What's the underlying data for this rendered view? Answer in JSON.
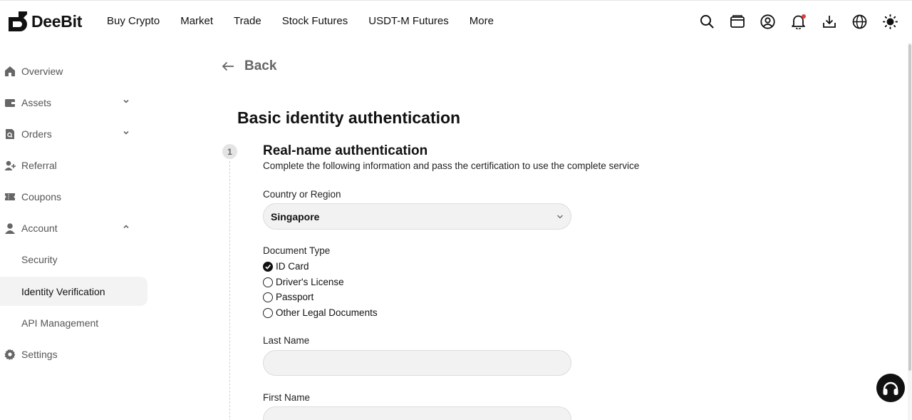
{
  "brand": {
    "name": "DeeBit"
  },
  "nav": {
    "items": [
      "Buy Crypto",
      "Market",
      "Trade",
      "Stock Futures",
      "USDT-M Futures",
      "More"
    ]
  },
  "header_icons": [
    "search-icon",
    "wallet-icon",
    "account-icon",
    "bell-icon",
    "download-icon",
    "globe-icon",
    "theme-sun-icon"
  ],
  "sidebar": {
    "items": [
      {
        "label": "Overview",
        "icon": "home-icon"
      },
      {
        "label": "Assets",
        "icon": "wallet-icon",
        "expand": "down"
      },
      {
        "label": "Orders",
        "icon": "orders-icon",
        "expand": "down"
      },
      {
        "label": "Referral",
        "icon": "referral-icon"
      },
      {
        "label": "Coupons",
        "icon": "coupon-icon"
      },
      {
        "label": "Account",
        "icon": "user-icon",
        "expand": "up"
      }
    ],
    "account_sub": [
      "Security",
      "Identity Verification",
      "API Management"
    ],
    "active": "Identity Verification",
    "settings": {
      "label": "Settings",
      "icon": "gear-icon"
    }
  },
  "main": {
    "back_label": "Back",
    "page_title": "Basic identity authentication",
    "step_number": "1",
    "section_title": "Real-name authentication",
    "section_desc": "Complete the following information and pass the certification to use the complete service",
    "country_label": "Country or Region",
    "country_value": "Singapore",
    "doc_type_label": "Document Type",
    "doc_types": [
      "ID Card",
      "Driver's License",
      "Passport",
      "Other Legal Documents"
    ],
    "doc_type_selected": "ID Card",
    "last_name_label": "Last Name",
    "last_name_value": "",
    "first_name_label": "First Name",
    "first_name_value": ""
  },
  "colors": {
    "notification_dot": "#e5383b",
    "input_bg": "#f2f2f2",
    "active_bg": "#f3f3f3"
  }
}
